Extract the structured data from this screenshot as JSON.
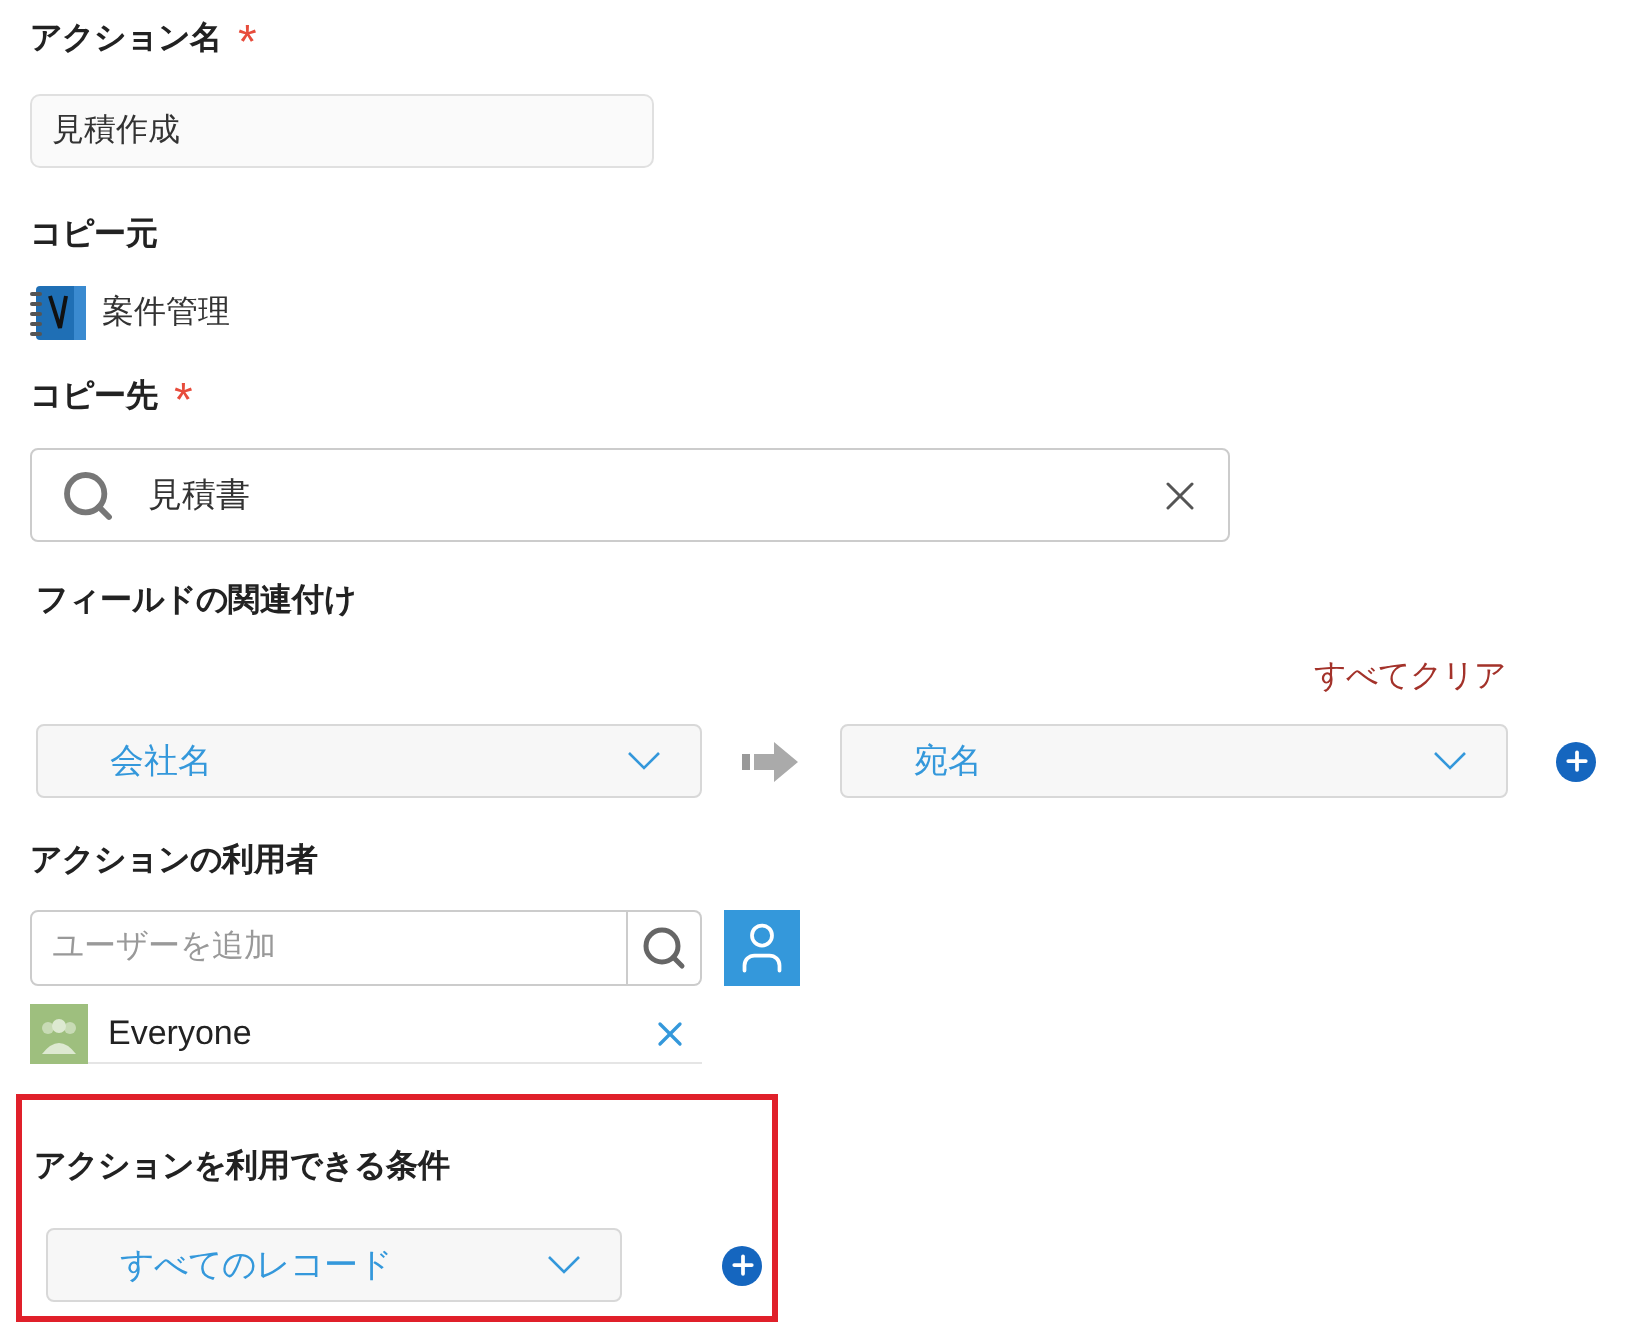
{
  "action_name": {
    "label": "アクション名",
    "required_mark": "*",
    "value": "見積作成"
  },
  "copy_source": {
    "label": "コピー元",
    "app_name": "案件管理"
  },
  "copy_target": {
    "label": "コピー先",
    "required_mark": "*",
    "value": "見積書"
  },
  "field_mapping": {
    "label": "フィールドの関連付け",
    "clear_all": "すべてクリア",
    "rows": [
      {
        "source": "会社名",
        "target": "宛名"
      }
    ]
  },
  "action_users": {
    "label": "アクションの利用者",
    "placeholder": "ユーザーを追加",
    "entries": [
      {
        "name": "Everyone"
      }
    ]
  },
  "conditions": {
    "label": "アクションを利用できる条件",
    "highlighted": true,
    "value": "すべてのレコード"
  }
}
